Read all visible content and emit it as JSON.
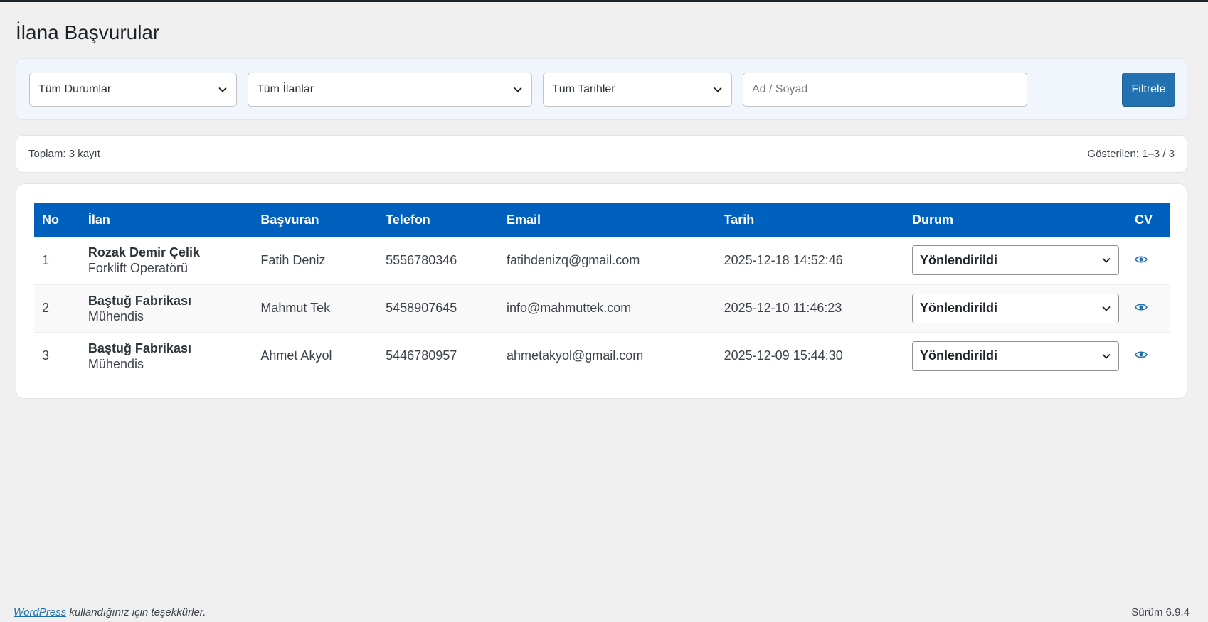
{
  "page": {
    "title": "İlana Başvurular"
  },
  "filters": {
    "status": {
      "selected": "Tüm Durumlar"
    },
    "listing": {
      "selected": "Tüm İlanlar"
    },
    "date": {
      "selected": "Tüm Tarihler"
    },
    "name": {
      "placeholder": "Ad / Soyad",
      "value": ""
    },
    "button_label": "Filtrele"
  },
  "summary": {
    "total": "Toplam: 3 kayıt",
    "showing": "Gösterilen: 1–3 / 3"
  },
  "table": {
    "headers": {
      "no": "No",
      "listing": "İlan",
      "applicant": "Başvuran",
      "phone": "Telefon",
      "email": "Email",
      "date": "Tarih",
      "status": "Durum",
      "cv": "CV"
    },
    "rows": [
      {
        "no": "1",
        "company": "Rozak Demir Çelik",
        "position": "Forklift Operatörü",
        "applicant": "Fatih Deniz",
        "phone": "5556780346",
        "email": "fatihdenizq@gmail.com",
        "date": "2025-12-18 14:52:46",
        "status": "Yönlendirildi",
        "cv_icon": "eye-icon"
      },
      {
        "no": "2",
        "company": "Baştuğ Fabrikası",
        "position": "Mühendis",
        "applicant": "Mahmut Tek",
        "phone": "5458907645",
        "email": "info@mahmuttek.com",
        "date": "2025-12-10 11:46:23",
        "status": "Yönlendirildi",
        "cv_icon": "eye-icon"
      },
      {
        "no": "3",
        "company": "Baştuğ Fabrikası",
        "position": "Mühendis",
        "applicant": "Ahmet Akyol",
        "phone": "5446780957",
        "email": "ahmetakyol@gmail.com",
        "date": "2025-12-09 15:44:30",
        "status": "Yönlendirildi",
        "cv_icon": "eye-icon"
      }
    ]
  },
  "footer": {
    "link_text": "WordPress",
    "thanks_text": " kullandığınız için teşekkürler.",
    "version": "Sürüm 6.9.4"
  },
  "colors": {
    "table_header": "#0060bd",
    "button": "#2271b1",
    "page_bg": "#f0f0f1"
  }
}
